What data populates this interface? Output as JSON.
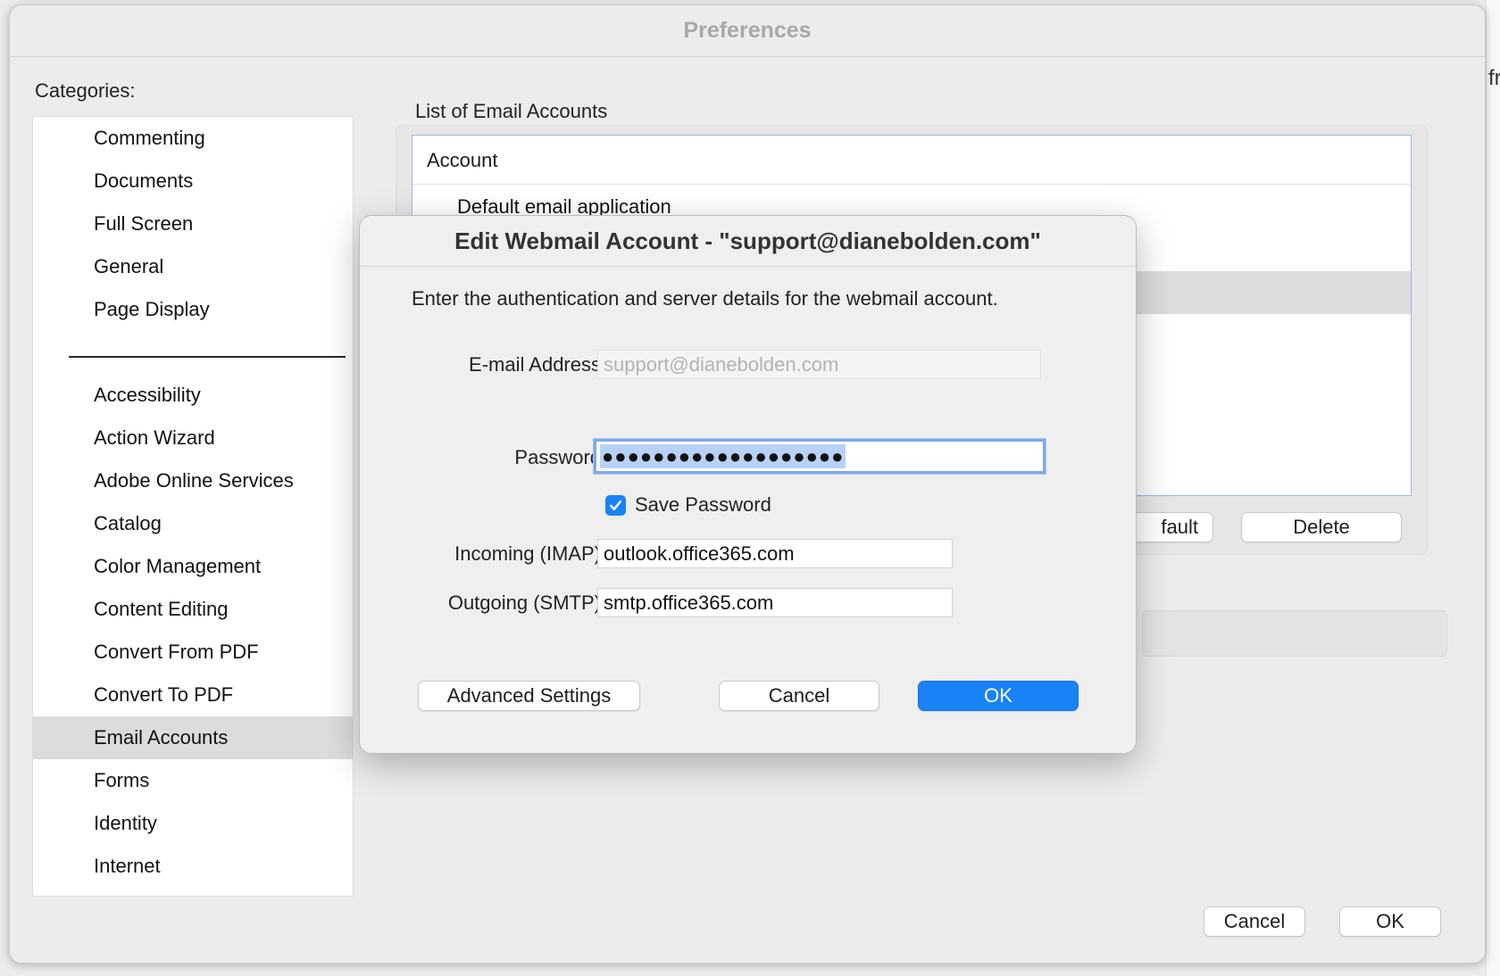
{
  "window": {
    "title": "Preferences"
  },
  "right_fragment": "fr",
  "categories": {
    "label": "Categories:",
    "top_items": [
      "Commenting",
      "Documents",
      "Full Screen",
      "General",
      "Page Display"
    ],
    "items": [
      "Accessibility",
      "Action Wizard",
      "Adobe Online Services",
      "Catalog",
      "Color Management",
      "Content Editing",
      "Convert From PDF",
      "Convert To PDF",
      "Email Accounts",
      "Forms",
      "Identity",
      "Internet"
    ],
    "selected": "Email Accounts"
  },
  "accounts": {
    "label": "List of Email Accounts",
    "column_header": "Account",
    "rows": [
      "Default email application"
    ],
    "set_default_partial": "fault",
    "delete_label": "Delete"
  },
  "footer": {
    "cancel_label": "Cancel",
    "ok_label": "OK"
  },
  "dialog": {
    "title": "Edit Webmail Account - \"support@dianebolden.com\"",
    "description": "Enter the authentication and server details for the webmail account.",
    "email_label": "E-mail Address",
    "email_value": "support@dianebolden.com",
    "password_label": "Password",
    "password_value": "●●●●●●●●●●●●●●●●●●●",
    "save_password_label": "Save Password",
    "save_password_checked": true,
    "incoming_label": "Incoming (IMAP)",
    "incoming_value": "outlook.office365.com",
    "outgoing_label": "Outgoing (SMTP)",
    "outgoing_value": "smtp.office365.com",
    "advanced_label": "Advanced Settings",
    "cancel_label": "Cancel",
    "ok_label": "OK"
  },
  "colors": {
    "accent": "#1a82f7",
    "focus_ring": "#7fa9ea",
    "selection": "#dcdcdc"
  }
}
